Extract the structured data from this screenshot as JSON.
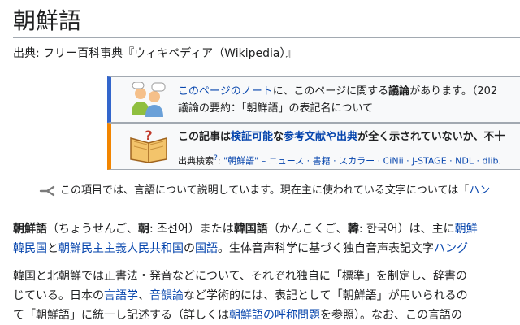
{
  "page": {
    "title": "朝鮮語",
    "source": "出典: フリー百科事典『ウィキペディア（Wikipedia）』"
  },
  "notice_box": {
    "line1_link": "このページのノート",
    "line1_mid": "に、このページに関する",
    "line1_bold": "議論",
    "line1_end": "があります。（202",
    "line2": "議論の要約：「朝鮮語」の表記名について",
    "icon": "discussion-people-icon"
  },
  "content_box": {
    "p1": "この記事は",
    "p2": "検証可能",
    "p3": "な",
    "p4": "参考文献や出典",
    "p5": "が全く示されていないか、不十",
    "search_label": "出典検索",
    "search_q": "?",
    "search_links": "\"朝鮮語\" – ニュース · 書籍 · スカラー · CiNii · J-STAGE · NDL · dlib.",
    "icon": "open-book-question-icon"
  },
  "hatnote": {
    "icon": "disambiguation-fork-icon",
    "text": "この項目では、言語について説明しています。現在主に使われている文字については「",
    "link": "ハン"
  },
  "para1": {
    "l1_a": "朝鮮語",
    "l1_b": "（ちょうせんご、",
    "l1_c": "朝",
    "l1_d": ": 조선어）または",
    "l1_e": "韓国語",
    "l1_f": "（かんこくご、",
    "l1_g": "韓",
    "l1_h": ": 한국어）は、主に",
    "l1_i": "朝鮮",
    "l2_a": "韓民国",
    "l2_b": "と",
    "l2_c": "朝鮮民主主義人民共和国",
    "l2_d": "の",
    "l2_e": "国語",
    "l2_f": "。生体音声科学に基づく独自音声表記文字",
    "l2_g": "ハング"
  },
  "para2": {
    "l1": "韓国と北朝鮮では正書法・発音などについて、それぞれ独自に「標準」を制定し、辞書の",
    "l2_a": "じている。日本の",
    "l2_b": "言語学",
    "l2_c": "、",
    "l2_d": "音韻論",
    "l2_e": "など学術的には、表記として「朝鮮語」が用いられるの",
    "l3_a": "て「朝鮮語」に統一し記述する（詳しくは",
    "l3_b": "朝鮮語の呼称問題",
    "l3_c": "を参照）。なお、この言語の"
  },
  "colors": {
    "link": "#0645ad",
    "notice_bar": "#3366cc",
    "content_bar": "#f28500",
    "box_bg": "#f8f9fa"
  }
}
